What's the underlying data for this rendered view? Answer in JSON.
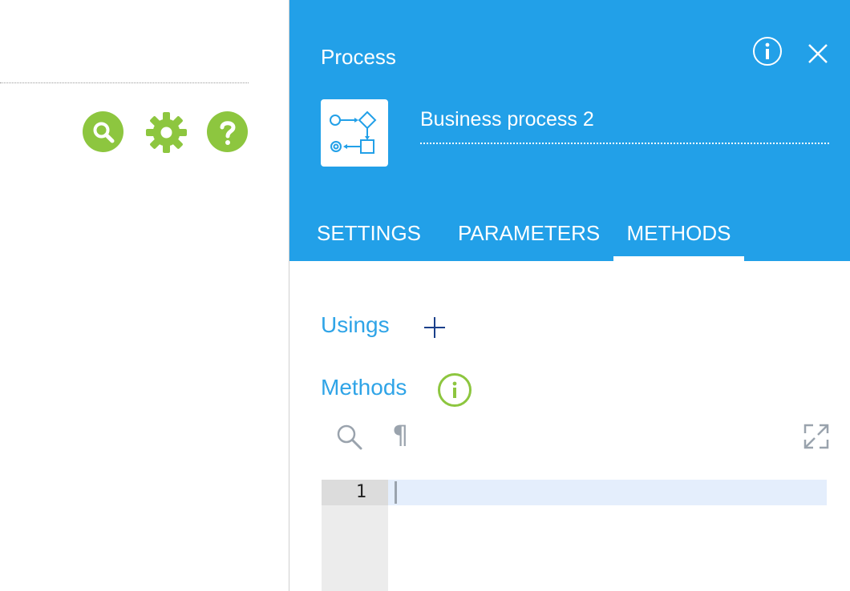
{
  "panel": {
    "title": "Process",
    "process_name": "Business process 2"
  },
  "tabs": [
    {
      "label": "SETTINGS"
    },
    {
      "label": "PARAMETERS"
    },
    {
      "label": "METHODS"
    }
  ],
  "sections": {
    "usings_label": "Usings",
    "methods_label": "Methods"
  },
  "editor": {
    "line_number": "1",
    "toolbar_pilcrow": "¶"
  },
  "icons": {
    "left_toolbar": [
      "search-icon",
      "gear-icon",
      "help-icon"
    ],
    "header": [
      "info-icon",
      "close-icon",
      "process-diagram-icon"
    ],
    "methods_toolbar": [
      "search-icon",
      "pilcrow-icon",
      "expand-icon"
    ]
  },
  "colors": {
    "header_bg": "#22a0e8",
    "accent_green": "#8dc63f",
    "section_label": "#2fa4e7"
  }
}
